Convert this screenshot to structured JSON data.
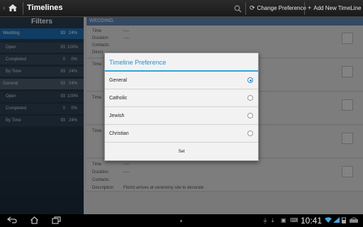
{
  "actionbar": {
    "title": "Timelines",
    "change_pref": "Change Preference",
    "add_new": "Add New TimeLine"
  },
  "filters": {
    "heading": "Filters",
    "rows": [
      {
        "label": "Wedding",
        "count": "93",
        "pct": "24%"
      },
      {
        "label": "Open",
        "count": "93",
        "pct": "100%"
      },
      {
        "label": "Completed",
        "count": "0",
        "pct": "0%"
      },
      {
        "label": "By Time",
        "count": "93",
        "pct": "24%"
      },
      {
        "label": "General",
        "count": "93",
        "pct": "24%"
      },
      {
        "label": "Open",
        "count": "93",
        "pct": "100%"
      },
      {
        "label": "Completed",
        "count": "0",
        "pct": "0%"
      },
      {
        "label": "By Time",
        "count": "93",
        "pct": "24%"
      }
    ]
  },
  "main": {
    "section": "WEDDING",
    "labels": {
      "time": "Time",
      "duration": "Duration",
      "contacts": "Contacts",
      "description": "Description",
      "description_short": "Descr",
      "dash": "----"
    },
    "last_description": "Florist arrives at ceremony site to decorate"
  },
  "dialog": {
    "title": "Timeline Preference",
    "options": [
      {
        "label": "General",
        "selected": true
      },
      {
        "label": "Catholic",
        "selected": false
      },
      {
        "label": "Jewish",
        "selected": false
      },
      {
        "label": "Christian",
        "selected": false
      }
    ],
    "set_label": "Set"
  },
  "statusbar": {
    "time": "10:41"
  },
  "icons": {
    "home": "home-icon",
    "search": "search-icon",
    "refresh": "refresh-icon",
    "add": "plus-icon",
    "back": "back-icon",
    "nav_home": "nav-home-icon",
    "recents": "recents-icon"
  },
  "colors": {
    "accent": "#33a3dc",
    "selected_filter": "#1e6fb6",
    "section_header": "#5f85b5"
  }
}
